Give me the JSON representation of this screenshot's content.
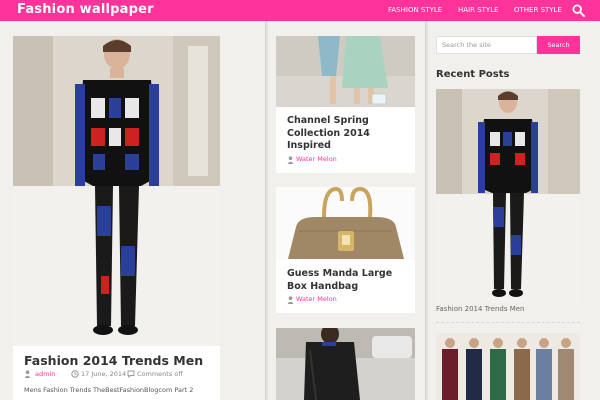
{
  "header": {
    "site_title": "Fashion wallpaper",
    "nav": [
      "FASHION STYLE",
      "HAIR STYLE",
      "OTHER STYLE"
    ]
  },
  "featured": {
    "title": "Fashion 2014 Trends Men",
    "author": "admin",
    "date": "17 June, 2014",
    "comments": "Comments off",
    "excerpt": "Mens Fashion Trends TheBestFashionBlogcom Part 2"
  },
  "posts": [
    {
      "title": "Channel Spring Collection 2014 Inspired",
      "author": "Water Melon"
    },
    {
      "title": "Guess Manda Large Box Handbag",
      "author": "Water Melon"
    }
  ],
  "sidebar": {
    "search_placeholder": "Search the site",
    "search_button": "Search",
    "recent_heading": "Recent Posts",
    "recent_posts": [
      "Fashion 2014 Trends Men"
    ]
  },
  "colors": {
    "accent": "#ff3399",
    "background": "#f2f0ec"
  }
}
